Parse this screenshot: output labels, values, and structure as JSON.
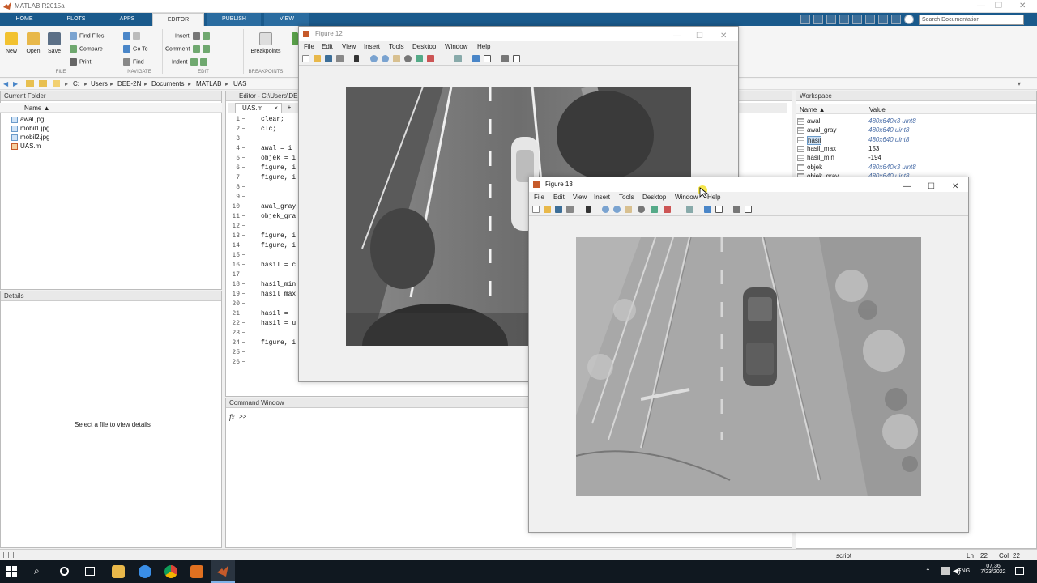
{
  "app": {
    "title": "MATLAB R2015a"
  },
  "ribbon_tabs": [
    "HOME",
    "PLOTS",
    "APPS",
    "EDITOR",
    "PUBLISH",
    "VIEW"
  ],
  "search_placeholder": "Search Documentation",
  "ribbon": {
    "new": "New",
    "open": "Open",
    "save": "Save",
    "find_files": "Find Files",
    "compare": "Compare",
    "print": "Print",
    "go_to": "Go To",
    "find": "Find",
    "insert": "Insert",
    "comment": "Comment",
    "indent": "Indent",
    "breakpoints": "Breakpoints",
    "groups": {
      "file": "FILE",
      "navigate": "NAVIGATE",
      "edit": "EDIT",
      "breakpoints": "BREAKPOINTS"
    }
  },
  "address": [
    "C:",
    "Users",
    "DEE-2N",
    "Documents",
    "MATLAB",
    "UAS"
  ],
  "current_folder": {
    "title": "Current Folder",
    "col_name": "Name ▲",
    "files": [
      "awal.jpg",
      "mobil1.jpg",
      "mobil2.jpg",
      "UAS.m"
    ]
  },
  "details": {
    "title": "Details",
    "empty": "Select a file to view details"
  },
  "editor": {
    "title": "Editor - C:\\Users\\DEE",
    "tab": "UAS.m",
    "add": "+",
    "lines": [
      {
        "n": "1",
        "t": "clear;"
      },
      {
        "n": "2",
        "t": "clc;"
      },
      {
        "n": "3",
        "t": ""
      },
      {
        "n": "4",
        "t": "awal  = i"
      },
      {
        "n": "5",
        "t": "objek = i"
      },
      {
        "n": "6",
        "t": "figure, i"
      },
      {
        "n": "7",
        "t": "figure, i"
      },
      {
        "n": "8",
        "t": ""
      },
      {
        "n": "9",
        "t": ""
      },
      {
        "n": "10",
        "t": "awal_gray"
      },
      {
        "n": "11",
        "t": "objek_gra"
      },
      {
        "n": "12",
        "t": ""
      },
      {
        "n": "13",
        "t": "figure, i"
      },
      {
        "n": "14",
        "t": "figure, i"
      },
      {
        "n": "15",
        "t": ""
      },
      {
        "n": "16",
        "t": "hasil = c"
      },
      {
        "n": "17",
        "t": ""
      },
      {
        "n": "18",
        "t": "hasil_min"
      },
      {
        "n": "19",
        "t": "hasil_max"
      },
      {
        "n": "20",
        "t": ""
      },
      {
        "n": "21",
        "t": "hasil = "
      },
      {
        "n": "22",
        "t": "hasil = u"
      },
      {
        "n": "23",
        "t": ""
      },
      {
        "n": "24",
        "t": "figure, i"
      },
      {
        "n": "25",
        "t": ""
      },
      {
        "n": "26",
        "t": ""
      }
    ]
  },
  "command_window": {
    "title": "Command Window",
    "fx": "fx",
    "prompt": ">>"
  },
  "workspace": {
    "title": "Workspace",
    "col_name": "Name ▲",
    "col_value": "Value",
    "vars": [
      {
        "name": "awal",
        "value": "480x640x3 uint8"
      },
      {
        "name": "awal_gray",
        "value": "480x640 uint8"
      },
      {
        "name": "hasil",
        "value": "480x640 uint8"
      },
      {
        "name": "hasil_max",
        "value": "153"
      },
      {
        "name": "hasil_min",
        "value": "-194"
      },
      {
        "name": "objek",
        "value": "480x640x3 uint8"
      },
      {
        "name": "objek_gray",
        "value": "480x640 uint8"
      }
    ]
  },
  "figure12": {
    "title": "Figure 12"
  },
  "figure13": {
    "title": "Figure 13"
  },
  "fig_menu": [
    "File",
    "Edit",
    "View",
    "Insert",
    "Tools",
    "Desktop",
    "Window",
    "Help"
  ],
  "statusbar": {
    "mode": "script",
    "ln_label": "Ln",
    "ln": "22",
    "col_label": "Col",
    "col": "22"
  },
  "taskbar": {
    "time": "07.36",
    "date": "7/23/2022",
    "lang": "ENG"
  },
  "colors": {
    "ribbon_tab_bg": "#1a5a8c",
    "taskbar_bg": "#101820",
    "matlab_orange": "#c65a2a"
  }
}
